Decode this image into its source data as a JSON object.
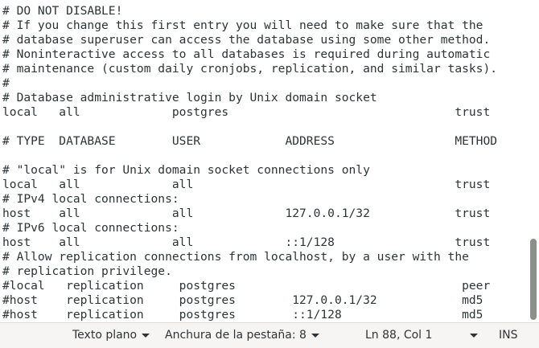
{
  "editor": {
    "lines": [
      "# DO NOT DISABLE!",
      "# If you change this first entry you will need to make sure that the",
      "# database superuser can access the database using some other method.",
      "# Noninteractive access to all databases is required during automatic",
      "# maintenance (custom daily cronjobs, replication, and similar tasks).",
      "#",
      "# Database administrative login by Unix domain socket",
      "local   all             postgres                                trust",
      "",
      "# TYPE  DATABASE        USER            ADDRESS                 METHOD",
      "",
      "# \"local\" is for Unix domain socket connections only",
      "local   all             all                                     trust",
      "# IPv4 local connections:",
      "host    all             all             127.0.0.1/32            trust",
      "# IPv6 local connections:",
      "host    all             all             ::1/128                 trust",
      "# Allow replication connections from localhost, by a user with the",
      "# replication privilege.",
      "#local   replication     postgres                                peer",
      "#host    replication     postgres        127.0.0.1/32            md5",
      "#host    replication     postgres        ::1/128                 md5"
    ]
  },
  "statusbar": {
    "syntax": "Texto plano",
    "tab_width": "Anchura de la pestaña: 8",
    "position": "Ln 88, Col 1",
    "insert_mode": "INS"
  }
}
